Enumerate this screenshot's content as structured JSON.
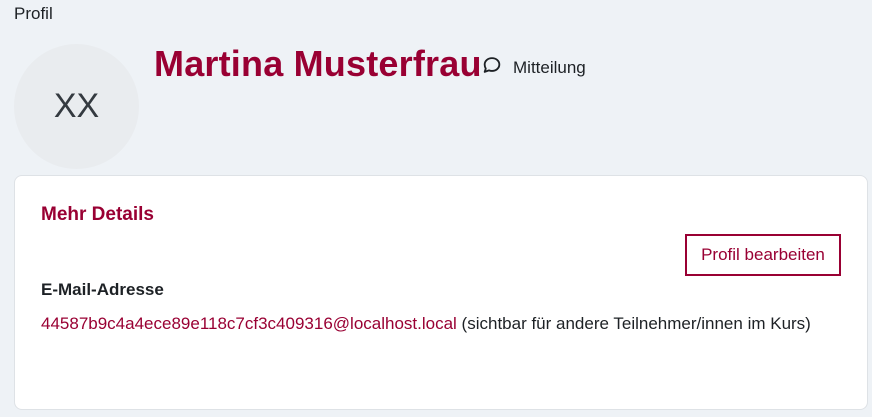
{
  "breadcrumb": "Profil",
  "avatar": {
    "initials": "XX"
  },
  "header": {
    "name": "Martina Musterfrau",
    "message_label": "Mitteilung"
  },
  "details": {
    "title": "Mehr Details",
    "edit_label": "Profil bearbeiten",
    "email_label": "E-Mail-Adresse",
    "email_value": "44587b9c4a4ece89e118c7cf3c409316@localhost.local",
    "email_note": " (sichtbar für andere Teilnehmer/innen im Kurs)"
  },
  "colors": {
    "accent": "#990033",
    "background": "#eef2f6",
    "avatar_bg": "#e9ecef"
  },
  "icons": {
    "message": "speech-bubble-icon"
  }
}
